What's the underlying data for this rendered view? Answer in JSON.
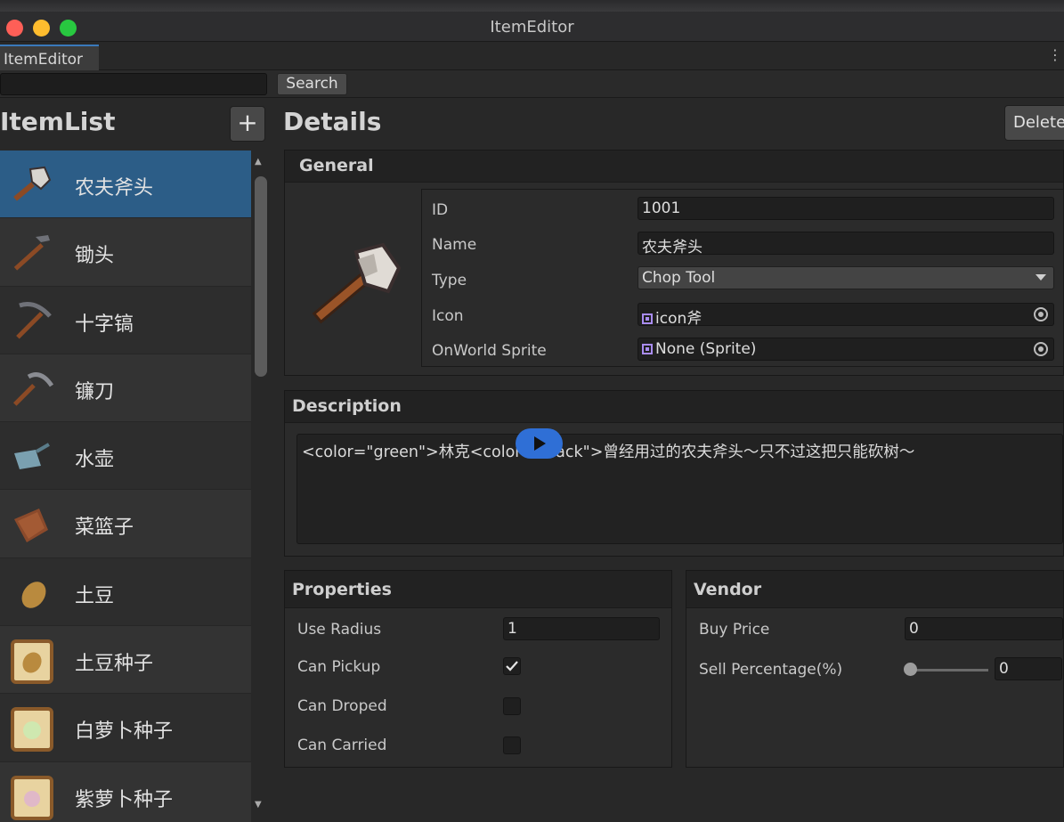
{
  "window": {
    "title": "ItemEditor"
  },
  "tab": {
    "label": "ItemEditor",
    "menu": "⋮"
  },
  "toolbar": {
    "search_value": "",
    "search_button": "Search"
  },
  "item_list": {
    "title": "ItemList",
    "add_label": "+",
    "items": [
      {
        "label": "农夫斧头",
        "icon": "axe-icon",
        "selected": true
      },
      {
        "label": "锄头",
        "icon": "hoe-icon"
      },
      {
        "label": "十字镐",
        "icon": "pickaxe-icon"
      },
      {
        "label": "镰刀",
        "icon": "sickle-icon"
      },
      {
        "label": "水壶",
        "icon": "watering-can-icon"
      },
      {
        "label": "菜篮子",
        "icon": "basket-icon"
      },
      {
        "label": "土豆",
        "icon": "potato-icon"
      },
      {
        "label": "土豆种子",
        "icon": "potato-seed-packet-icon"
      },
      {
        "label": "白萝卜种子",
        "icon": "white-radish-seed-packet-icon"
      },
      {
        "label": "紫萝卜种子",
        "icon": "purple-radish-seed-packet-icon"
      }
    ]
  },
  "details": {
    "title": "Details",
    "delete_label": "Delete",
    "general": {
      "header": "General",
      "preview_icon": "axe-icon",
      "id_label": "ID",
      "id_value": "1001",
      "name_label": "Name",
      "name_value": "农夫斧头",
      "type_label": "Type",
      "type_value": "Chop Tool",
      "icon_label": "Icon",
      "icon_value": "icon斧",
      "onworld_label": "OnWorld Sprite",
      "onworld_value": "None (Sprite)"
    },
    "description": {
      "header": "Description",
      "text": "<color=\"green\">林克<color=\"black\">曾经用过的农夫斧头～只不过这把只能砍树～"
    },
    "properties": {
      "header": "Properties",
      "use_radius_label": "Use Radius",
      "use_radius_value": "1",
      "can_pickup_label": "Can Pickup",
      "can_pickup": true,
      "can_droped_label": "Can Droped",
      "can_droped": false,
      "can_carried_label": "Can Carried",
      "can_carried": false
    },
    "vendor": {
      "header": "Vendor",
      "buy_price_label": "Buy Price",
      "buy_price_value": "0",
      "sell_percentage_label": "Sell Percentage(%)",
      "sell_percentage_value": "0"
    }
  },
  "colors": {
    "selection": "#2c5d87",
    "tab_accent": "#3a79bb",
    "object_icon": "#a98cf0",
    "overlay_play": "#2f6fd6"
  }
}
